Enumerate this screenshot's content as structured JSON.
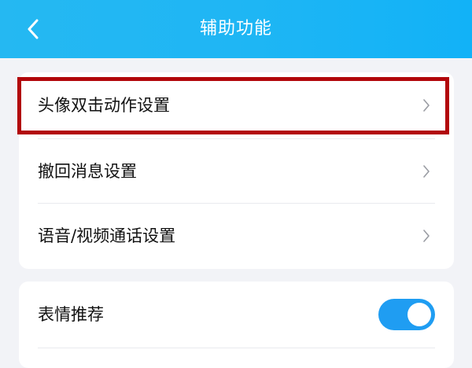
{
  "header": {
    "title": "辅助功能",
    "back_icon": "chevron-left-icon"
  },
  "settings_group_1": {
    "items": [
      {
        "label": "头像双击动作设置",
        "icon": "chevron-right-icon"
      },
      {
        "label": "撤回消息设置",
        "icon": "chevron-right-icon"
      },
      {
        "label": "语音/视频通话设置",
        "icon": "chevron-right-icon"
      }
    ]
  },
  "settings_group_2": {
    "items": [
      {
        "label": "表情推荐",
        "toggle_on": true
      }
    ]
  },
  "colors": {
    "header_start": "#25b8f2",
    "header_end": "#12b2f7",
    "toggle_on": "#1f9df2",
    "highlight_border": "#b2070b",
    "page_background": "#f2f3f7"
  }
}
